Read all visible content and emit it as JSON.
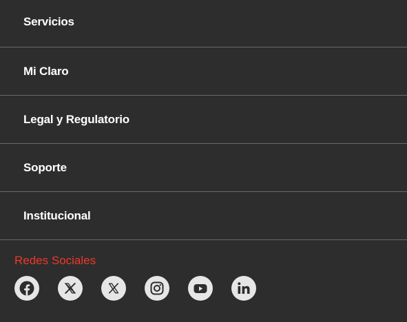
{
  "menu": {
    "items": [
      {
        "label": "Servicios"
      },
      {
        "label": "Mi Claro"
      },
      {
        "label": "Legal y Regulatorio"
      },
      {
        "label": "Soporte"
      },
      {
        "label": "Institucional"
      }
    ]
  },
  "social": {
    "title": "Redes Sociales",
    "icons": [
      "facebook-icon",
      "x-icon",
      "x-icon",
      "instagram-icon",
      "youtube-icon",
      "linkedin-icon"
    ]
  },
  "colors": {
    "background": "#2d2d2d",
    "accent": "#ef3829",
    "divider": "#6a6a6a",
    "icon_bg": "#e6e6e6",
    "icon_fg": "#2d2d2d"
  }
}
